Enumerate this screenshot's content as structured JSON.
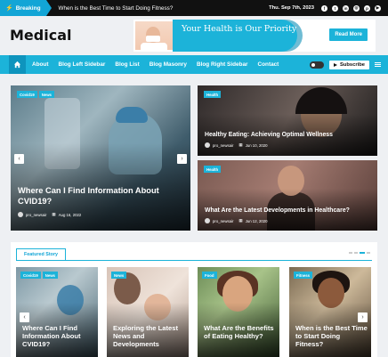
{
  "topbar": {
    "breaking_label": "Breaking",
    "ticker_text": "When is the Best Time to Start Doing Fitness?",
    "date": "Thu. Sep 7th, 2023",
    "social_icons": [
      "facebook-icon",
      "twitter-icon",
      "linkedin-icon",
      "instagram-icon",
      "pinterest-icon",
      "youtube-icon"
    ]
  },
  "header": {
    "logo": "Medical",
    "banner": {
      "headline": "Your Health is Our Priority",
      "button_label": "Read More"
    }
  },
  "nav": {
    "items": [
      "About",
      "Blog Left Sidebar",
      "Blog List",
      "Blog Masonry",
      "Blog Right Sidebar",
      "Contact"
    ],
    "subscribe_label": "Subscribe"
  },
  "hero": {
    "main": {
      "tags": [
        "Covid19",
        "News"
      ],
      "title": "Where Can I Find Information About CVID19?",
      "author": "pro_newsair",
      "date": "Aug 16, 2022"
    },
    "side": [
      {
        "tags": [
          "Health"
        ],
        "title": "Healthy Eating: Achieving Optimal Wellness",
        "author": "pro_newsair",
        "date": "Jun 10, 2020"
      },
      {
        "tags": [
          "Health"
        ],
        "title": "What Are the Latest Developments in Healthcare?",
        "author": "pro_newsair",
        "date": "Jun 12, 2020"
      }
    ]
  },
  "featured": {
    "label": "Featured Story",
    "cards": [
      {
        "tags": [
          "Covid19",
          "News"
        ],
        "title": "Where Can I Find Information About CVID19?"
      },
      {
        "tags": [
          "News"
        ],
        "title": "Exploring the Latest News and Developments"
      },
      {
        "tags": [
          "Food"
        ],
        "title": "What Are the Benefits of Eating Healthy?"
      },
      {
        "tags": [
          "Fitness"
        ],
        "title": "When is the Best Time to Start Doing Fitness?"
      }
    ]
  },
  "colors": {
    "accent": "#1cb3d9",
    "topbar": "#111111"
  }
}
